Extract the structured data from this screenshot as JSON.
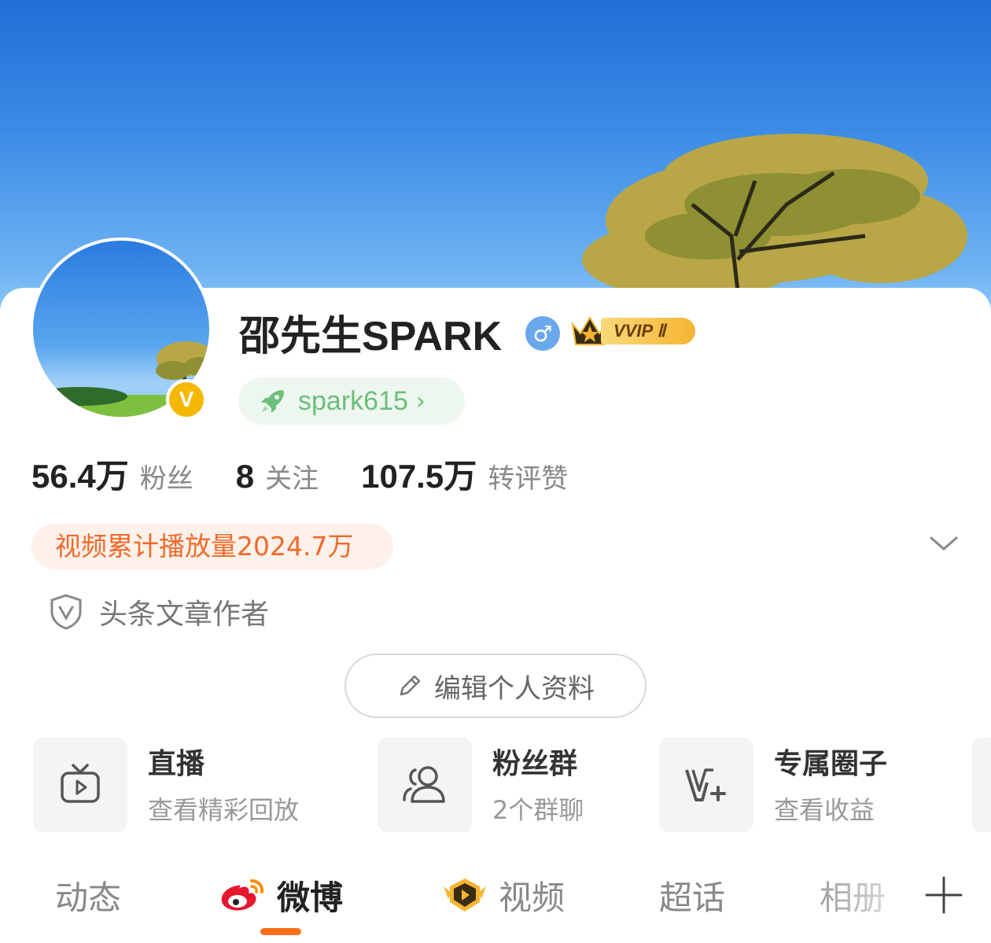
{
  "profile": {
    "name": "邵先生SPARK",
    "gender_symbol": "♂",
    "vip_label": "VVIP Ⅱ",
    "verified_symbol": "V",
    "handle": "spark615",
    "handle_chevron": "›"
  },
  "stats": [
    {
      "value": "56.4万",
      "label": "粉丝"
    },
    {
      "value": "8",
      "label": "关注"
    },
    {
      "value": "107.5万",
      "label": "转评赞"
    }
  ],
  "video_plays": "视频累计播放量2024.7万",
  "certification": "头条文章作者",
  "edit_profile": "编辑个人资料",
  "features": [
    {
      "title": "直播",
      "subtitle": "查看精彩回放",
      "icon": "tv-play-icon"
    },
    {
      "title": "粉丝群",
      "subtitle": "2个群聊",
      "icon": "group-icon"
    },
    {
      "title": "专属圈子",
      "subtitle": "查看收益",
      "icon": "v-plus-icon"
    }
  ],
  "tabs": [
    {
      "label": "动态",
      "active": false
    },
    {
      "label": "微博",
      "active": true,
      "icon": "weibo-logo-icon"
    },
    {
      "label": "视频",
      "active": false,
      "icon": "video-badge-icon"
    },
    {
      "label": "超话",
      "active": false
    },
    {
      "label": "相册",
      "active": false
    }
  ],
  "colors": {
    "accent_orange": "#ff6f1a",
    "video_pill_text": "#f06a2b",
    "handle_green": "#6bbf7a",
    "vip_gold": "#f5b533",
    "verified_gold": "#f5b800"
  }
}
